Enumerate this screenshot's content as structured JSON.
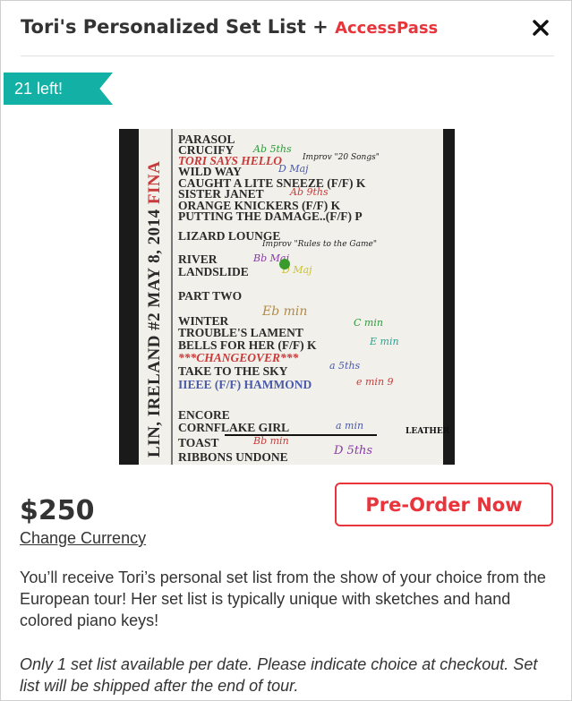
{
  "header": {
    "title": "Tori's Personalized Set List",
    "plus": "+",
    "brand": "AccessPass"
  },
  "badge": {
    "text": "21 left!"
  },
  "photo": {
    "side_text": "LIN, IRELAND #2   MAY 8, 2014",
    "side_final": "FINA",
    "songs": [
      "PARASOL",
      "CRUCIFY",
      "TORI SAYS HELLO",
      "WILD WAY",
      "CAUGHT A LITE SNEEZE (F/F) K",
      "SISTER JANET",
      "ORANGE KNICKERS (F/F) K",
      "PUTTING THE DAMAGE..(F/F) P",
      "LIZARD LOUNGE",
      "RIVER",
      "LANDSLIDE",
      "PART TWO",
      "WINTER",
      "TROUBLE'S LAMENT",
      "BELLS FOR HER (F/F) K",
      "***CHANGEOVER***",
      "TAKE TO THE SKY",
      "IIEEE (F/F) HAMMOND",
      "ENCORE",
      "CORNFLAKE GIRL",
      "TOAST",
      "RIBBONS UNDONE"
    ],
    "marks": [
      "Ab 5ths",
      "Improv \"20 Songs\"",
      "D Maj",
      "Ab 9ths",
      "Improv \"Rules to the Game\"",
      "Bb Maj",
      "D Maj",
      "Eb min",
      "C min",
      "E min",
      "a 5ths",
      "e min 9",
      "a min",
      "LEATHER",
      "Bb min",
      "D 5ths"
    ]
  },
  "pricing": {
    "price": "$250",
    "change_currency": "Change Currency",
    "cta": "Pre-Order Now"
  },
  "description": "You’ll receive Tori’s personal set list from the show of your choice from the European tour! Her set list is typically unique with sketches and hand colored piano keys!",
  "note": "Only 1 set list available per date. Please indicate choice at checkout. Set list will be shipped after the end of tour.",
  "colors": {
    "accent": "#e8343a",
    "ribbon": "#13b0a5",
    "text": "#333333"
  }
}
